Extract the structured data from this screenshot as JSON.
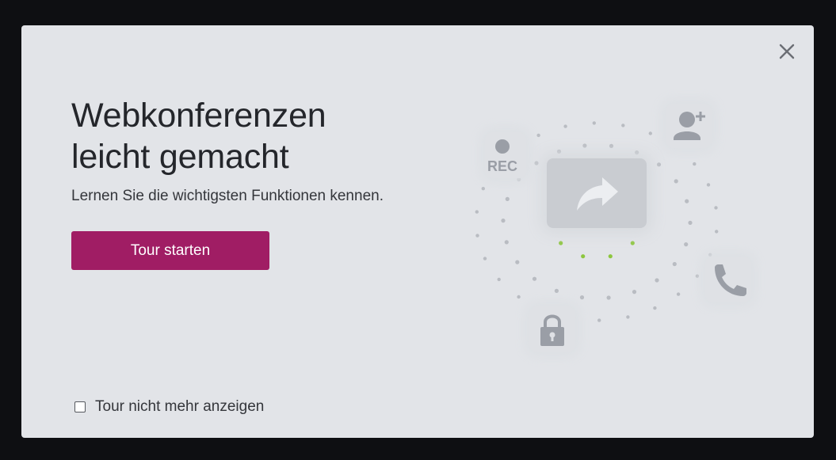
{
  "dialog": {
    "title_line1": "Webkonferenzen",
    "title_line2": "leicht gemacht",
    "subtitle": "Lernen Sie die wichtigsten Funktionen kennen.",
    "start_button_label": "Tour starten",
    "dont_show_label": "Tour nicht mehr anzeigen",
    "dont_show_checked": false,
    "close_icon": "close-icon"
  },
  "illustration": {
    "rec_label": "REC",
    "icons": [
      "record-icon",
      "add-user-icon",
      "share-screen-icon",
      "phone-icon",
      "lock-icon"
    ]
  },
  "colors": {
    "overlay": "#0e0f12",
    "dialog_bg": "#e2e4e8",
    "accent": "#a01d64",
    "icon_gray": "#9a9ea6",
    "dot_gray": "#b9bcc2",
    "dot_green": "#8dc63f"
  }
}
